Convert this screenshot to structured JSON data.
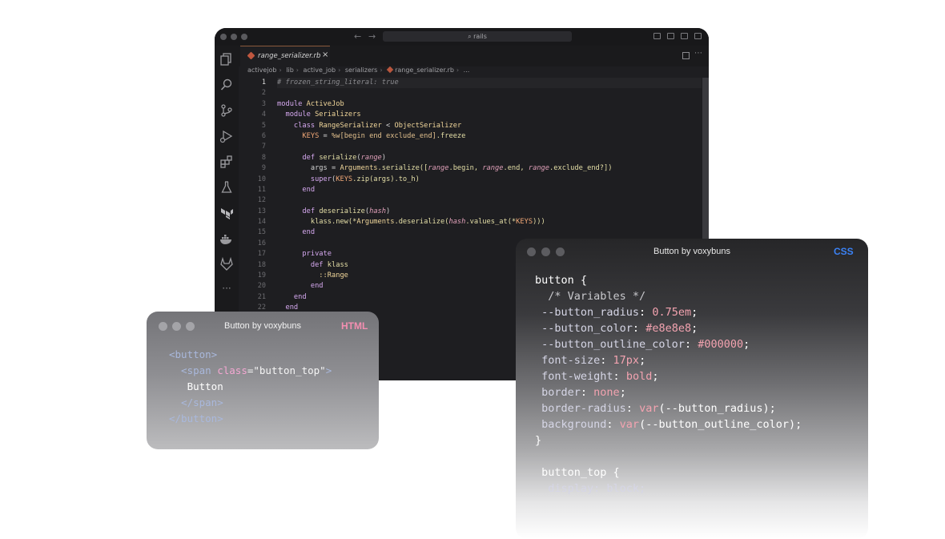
{
  "editor": {
    "search_text": "rails",
    "nav_back": "←",
    "nav_forward": "→",
    "tab": {
      "label": "range_serializer.rb",
      "close": "×"
    },
    "tab_more": "⋯",
    "breadcrumb": [
      "activejob",
      "lib",
      "active_job",
      "serializers",
      "range_serializer.rb",
      "..."
    ],
    "activity_more": "···",
    "line_numbers": [
      "1",
      "2",
      "3",
      "4",
      "5",
      "6",
      "7",
      "8",
      "9",
      "10",
      "11",
      "12",
      "13",
      "14",
      "15",
      "16",
      "17",
      "18",
      "19",
      "20",
      "21",
      "22"
    ],
    "code": [
      [
        {
          "t": "# frozen_string_literal: true",
          "c": "c-cmt"
        }
      ],
      [],
      [
        {
          "t": "module ",
          "c": "c-kw"
        },
        {
          "t": "ActiveJob",
          "c": "c-cls"
        }
      ],
      [
        {
          "t": "  module ",
          "c": "c-kw"
        },
        {
          "t": "Serializers",
          "c": "c-cls"
        }
      ],
      [
        {
          "t": "    class ",
          "c": "c-kw"
        },
        {
          "t": "RangeSerializer",
          "c": "c-cls"
        },
        {
          "t": " < ",
          "c": "c-pl"
        },
        {
          "t": "ObjectSerializer",
          "c": "c-cls"
        }
      ],
      [
        {
          "t": "      KEYS",
          "c": "c-const"
        },
        {
          "t": " = ",
          "c": "c-pl"
        },
        {
          "t": "%w[begin end exclude_end]",
          "c": "c-kw2"
        },
        {
          "t": ".freeze",
          "c": "c-mth"
        }
      ],
      [],
      [
        {
          "t": "      def ",
          "c": "c-kw"
        },
        {
          "t": "serialize",
          "c": "c-mth"
        },
        {
          "t": "(",
          "c": "c-pl"
        },
        {
          "t": "range",
          "c": "c-var"
        },
        {
          "t": ")",
          "c": "c-pl"
        }
      ],
      [
        {
          "t": "        args",
          "c": "c-pl"
        },
        {
          "t": " = ",
          "c": "c-pl"
        },
        {
          "t": "Arguments",
          "c": "c-cls"
        },
        {
          "t": ".serialize([",
          "c": "c-mth"
        },
        {
          "t": "range",
          "c": "c-var"
        },
        {
          "t": ".begin, ",
          "c": "c-mth"
        },
        {
          "t": "range",
          "c": "c-var"
        },
        {
          "t": ".end, ",
          "c": "c-mth"
        },
        {
          "t": "range",
          "c": "c-var"
        },
        {
          "t": ".exclude_end?])",
          "c": "c-mth"
        }
      ],
      [
        {
          "t": "        super",
          "c": "c-kw"
        },
        {
          "t": "(",
          "c": "c-pl"
        },
        {
          "t": "KEYS",
          "c": "c-const"
        },
        {
          "t": ".zip(args).to_h)",
          "c": "c-mth"
        }
      ],
      [
        {
          "t": "      end",
          "c": "c-kw"
        }
      ],
      [],
      [
        {
          "t": "      def ",
          "c": "c-kw"
        },
        {
          "t": "deserialize",
          "c": "c-mth"
        },
        {
          "t": "(",
          "c": "c-pl"
        },
        {
          "t": "hash",
          "c": "c-var"
        },
        {
          "t": ")",
          "c": "c-pl"
        }
      ],
      [
        {
          "t": "        klass.new(*",
          "c": "c-mth"
        },
        {
          "t": "Arguments",
          "c": "c-cls"
        },
        {
          "t": ".deserialize(",
          "c": "c-mth"
        },
        {
          "t": "hash",
          "c": "c-var"
        },
        {
          "t": ".values_at(*",
          "c": "c-mth"
        },
        {
          "t": "KEYS",
          "c": "c-const"
        },
        {
          "t": ")))",
          "c": "c-mth"
        }
      ],
      [
        {
          "t": "      end",
          "c": "c-kw"
        }
      ],
      [],
      [
        {
          "t": "      private",
          "c": "c-kw"
        }
      ],
      [
        {
          "t": "        def ",
          "c": "c-kw"
        },
        {
          "t": "klass",
          "c": "c-mth"
        }
      ],
      [
        {
          "t": "          ::Range",
          "c": "c-cls"
        }
      ],
      [
        {
          "t": "        end",
          "c": "c-kw"
        }
      ],
      [
        {
          "t": "    end",
          "c": "c-kw"
        }
      ],
      [
        {
          "t": "  end",
          "c": "c-kw"
        }
      ]
    ]
  },
  "html_card": {
    "title": "Button by voxybuns",
    "lang": "HTML",
    "lang_color": "#f48fb1",
    "code": [
      [
        {
          "t": "<button>",
          "c": "h-tag"
        }
      ],
      [
        {
          "t": "  <span ",
          "c": "h-tag"
        },
        {
          "t": "class",
          "c": "h-attr"
        },
        {
          "t": "=\"button_top\"",
          "c": "h-str"
        },
        {
          "t": ">",
          "c": "h-tag"
        }
      ],
      [
        {
          "t": "   Button",
          "c": "h-txt"
        }
      ],
      [
        {
          "t": "  </span>",
          "c": "h-tag"
        }
      ],
      [
        {
          "t": "</button>",
          "c": "h-tag"
        }
      ]
    ]
  },
  "css_card": {
    "title": "Button by voxybuns",
    "lang": "CSS",
    "lang_color": "#3b82f6",
    "code": [
      [
        {
          "t": "button {",
          "c": "css-sel"
        }
      ],
      [
        {
          "t": "  /* Variables */",
          "c": "css-cmt"
        }
      ],
      [
        {
          "t": " --button_radius",
          "c": "css-prop"
        },
        {
          "t": ": ",
          "c": "css-sel"
        },
        {
          "t": "0.75em",
          "c": "css-val"
        },
        {
          "t": ";",
          "c": "css-sel"
        }
      ],
      [
        {
          "t": " --button_color",
          "c": "css-prop"
        },
        {
          "t": ": ",
          "c": "css-sel"
        },
        {
          "t": "#e8e8e8",
          "c": "css-val"
        },
        {
          "t": ";",
          "c": "css-sel"
        }
      ],
      [
        {
          "t": " --button_outline_color",
          "c": "css-prop"
        },
        {
          "t": ": ",
          "c": "css-sel"
        },
        {
          "t": "#000000",
          "c": "css-val"
        },
        {
          "t": ";",
          "c": "css-sel"
        }
      ],
      [
        {
          "t": " font-size",
          "c": "css-prop"
        },
        {
          "t": ": ",
          "c": "css-sel"
        },
        {
          "t": "17px",
          "c": "css-val"
        },
        {
          "t": ";",
          "c": "css-sel"
        }
      ],
      [
        {
          "t": " font-weight",
          "c": "css-prop"
        },
        {
          "t": ": ",
          "c": "css-sel"
        },
        {
          "t": "bold",
          "c": "css-val"
        },
        {
          "t": ";",
          "c": "css-sel"
        }
      ],
      [
        {
          "t": " border",
          "c": "css-prop"
        },
        {
          "t": ": ",
          "c": "css-sel"
        },
        {
          "t": "none",
          "c": "css-val"
        },
        {
          "t": ";",
          "c": "css-sel"
        }
      ],
      [
        {
          "t": " border-radius",
          "c": "css-prop"
        },
        {
          "t": ": ",
          "c": "css-sel"
        },
        {
          "t": "var",
          "c": "css-fn"
        },
        {
          "t": "(--button_radius);",
          "c": "css-sel"
        }
      ],
      [
        {
          "t": " background",
          "c": "css-prop"
        },
        {
          "t": ": ",
          "c": "css-sel"
        },
        {
          "t": "var",
          "c": "css-fn"
        },
        {
          "t": "(--button_outline_color);",
          "c": "css-sel"
        }
      ],
      [
        {
          "t": "}",
          "c": "css-sel"
        }
      ],
      [],
      [
        {
          "t": " button_top {",
          "c": "css-sel"
        }
      ],
      [
        {
          "t": "  display: block;",
          "c": "css-prop"
        }
      ]
    ]
  }
}
